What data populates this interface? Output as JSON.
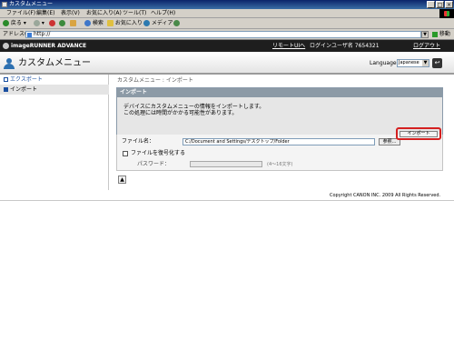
{
  "window": {
    "title": "カスタムメニュー"
  },
  "menu": {
    "items": [
      "ファイル(F)",
      "編集(E)",
      "表示(V)",
      "お気に入り(A)",
      "ツール(T)",
      "ヘルプ(H)"
    ]
  },
  "toolbar": {
    "back": "戻る",
    "search": "検索",
    "favorites": "お気に入り",
    "media": "メディア"
  },
  "address": {
    "label": "アドレス(D)",
    "value": "http://",
    "go": "移動"
  },
  "header": {
    "brand": "imageRUNNER ADVANCE",
    "remote_ui": "リモートUIへ",
    "login_user": "ログインユーザ名 7654321",
    "logout": "ログアウト"
  },
  "page": {
    "title": "カスタムメニュー",
    "language_label": "Language",
    "language_value": "Japanese"
  },
  "sidebar": {
    "items": [
      {
        "label": "エクスポート"
      },
      {
        "label": "インポート"
      }
    ]
  },
  "main": {
    "breadcrumb": "カスタムメニュー : インポート",
    "panel_title": "インポート",
    "message_line1": "デバイスにカスタムメニューの情報をインポートします。",
    "message_line2": "この処理には時間がかかる可能性があります。",
    "import_button": "インポート",
    "file_label": "ファイル名：",
    "file_value": "C:/Document and Settings/デスクトップ/Folder",
    "browse_button": "参照...",
    "encrypt_label": "ファイルを復号化する",
    "password_label": "パスワード：",
    "password_hint": "(4～16文字)"
  },
  "footer": {
    "copyright": "Copyright CANON INC. 2009 All Rights Reserved."
  }
}
